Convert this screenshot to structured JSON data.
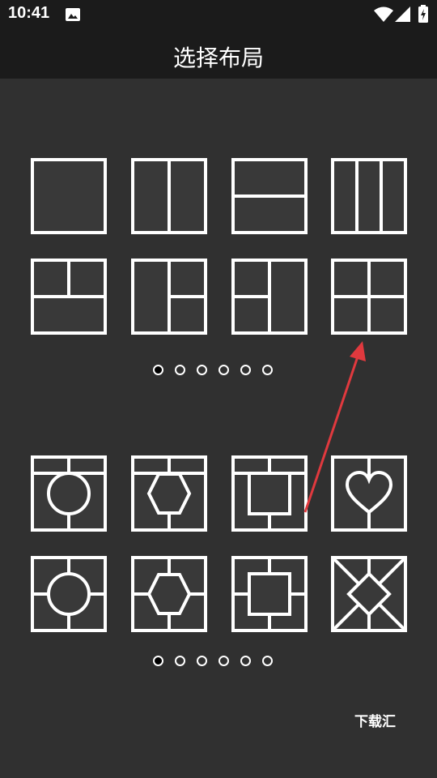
{
  "status_bar": {
    "time": "10:41",
    "icons": [
      "image-icon",
      "wifi-icon",
      "signal-icon",
      "battery-charging-icon"
    ]
  },
  "app_bar": {
    "title": "选择布局"
  },
  "rect_layouts": {
    "items": [
      "full",
      "split-vertical-2",
      "split-horizontal-2",
      "split-vertical-3",
      "top-split-bottom-full",
      "left-full-right-split",
      "left-split-right-full",
      "grid-2x2"
    ],
    "page_indicator": {
      "pages": 6,
      "active_index": 0
    }
  },
  "shape_layouts": {
    "items": [
      "circle-3-part",
      "hexagon-3-part",
      "square-3-part",
      "heart-2-part",
      "circle-4-part",
      "hexagon-4-part",
      "square-4-part",
      "diamond-4-part"
    ],
    "page_indicator": {
      "pages": 6,
      "active_index": 0
    }
  },
  "annotation": {
    "arrow_color": "#e0393e"
  },
  "watermark": {
    "text": "下载汇"
  },
  "colors": {
    "background": "#303030",
    "bar": "#1b1b1b",
    "tile_fill": "#393939",
    "stroke": "#ffffff"
  }
}
